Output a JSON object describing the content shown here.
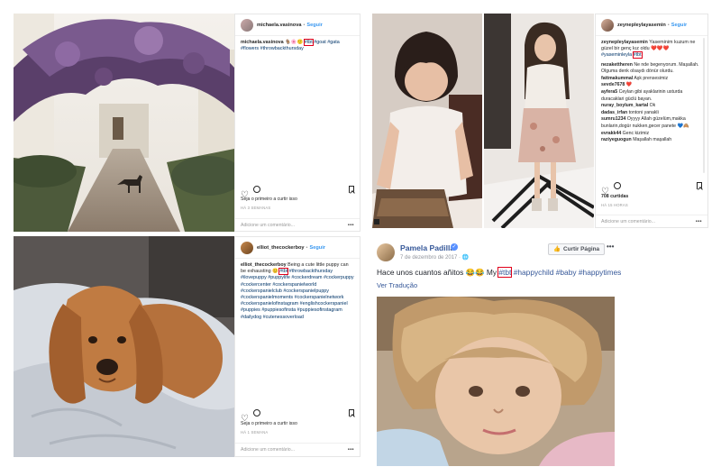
{
  "post1": {
    "username": "michaela.vasinova",
    "follow_label": "Seguir",
    "caption_user": "michaela.vasinova",
    "caption_tags_line1": [
      "#tbt",
      "#goat",
      "#gata"
    ],
    "caption_tags_line2": [
      "#flowers",
      "#throwbackthursday"
    ],
    "likes_text": "Seja o primeiro a curtir isso",
    "time_text": "HÁ 3 SEMANAS",
    "add_comment": "Adicione um comentário...",
    "more": "•••"
  },
  "post2": {
    "username": "zeynepleylayasemin",
    "follow_label": "Seguir",
    "caption_user": "zeynepleylayasemin",
    "caption_text": "Yaseminim kuzum ne güzel bir genç kız oldu",
    "caption_tags": [
      "#yaseminleyla",
      "#tbt"
    ],
    "comments": [
      {
        "user": "nezakettheren",
        "text": "Ne nde begenyorum. Maşallah. Olguma denk olsaydı dönür olurdu."
      },
      {
        "user": "fattmakummal",
        "text": "Aşk prensesimiz"
      },
      {
        "user": "sevde7678",
        "text": "❤️"
      },
      {
        "user": "ayfera5",
        "text": "Ceylan gibi ayaklarinin usturda duracaklari güclü bayan."
      },
      {
        "user": "nuray_boylum_kartal",
        "text": "Ok"
      },
      {
        "user": "dadas_irfan",
        "text": "tontoni yanakli"
      },
      {
        "user": "sumru1234",
        "text": "Oyyyy Allah güzelüm,makka bunlarin,dogür nukken,gecer panete 💙🙈"
      },
      {
        "user": "evrakk44",
        "text": "Genc kizimiz"
      },
      {
        "user": "raziyeguogun",
        "text": "Maşallah maşallah"
      }
    ],
    "likes_text": "708 curtidas",
    "time_text": "HÁ 15 HORAS",
    "add_comment": "Adicione um comentário...",
    "more": "•••"
  },
  "post3": {
    "username": "elliot_thecockerboy",
    "follow_label": "Seguir",
    "caption_user": "elliot_thecockerboy",
    "caption_text": "Being a cute little puppy can be exhausting 😊",
    "caption_hl_tag": "#tbt",
    "caption_tags": [
      "#throwbackthursday",
      "#ilovepuppy",
      "#puppylife",
      "#cockerdream",
      "#cockerpuppy",
      "#cockercenter",
      "#cockerspanielworld",
      "#cockerspanielclub",
      "#cockerspanielpuppy",
      "#cockerspanielmoments",
      "#cockerspanielnetwork",
      "#cockerspanielofinstagram",
      "#englishcockerspaniel",
      "#puppies",
      "#puppiesofinsta",
      "#puppiesofinstagram",
      "#dailydog",
      "#cutenessoverload"
    ],
    "likes_text": "Seja o primeiro a curtir isso",
    "time_text": "HÁ 1 SEMANA",
    "add_comment": "Adicione um comentário...",
    "more": "•••"
  },
  "fb": {
    "name": "Pamela Padilla",
    "verified_icon": "✓",
    "date": "7 de dezembro de 2017 · 🌐",
    "like_label": "Curtir Página",
    "more": "•••",
    "text_prefix": "Hace unos cuantos añitos 😂😂 My ",
    "text_tag_hl": "#tbt",
    "text_tags": [
      "#happychild",
      "#baby",
      "#happytimes"
    ],
    "translate": "Ver Tradução"
  },
  "colors": {
    "ig_link": "#003569",
    "ig_follow": "#3897f0",
    "fb_link": "#365899",
    "highlight": "#e0001b"
  }
}
